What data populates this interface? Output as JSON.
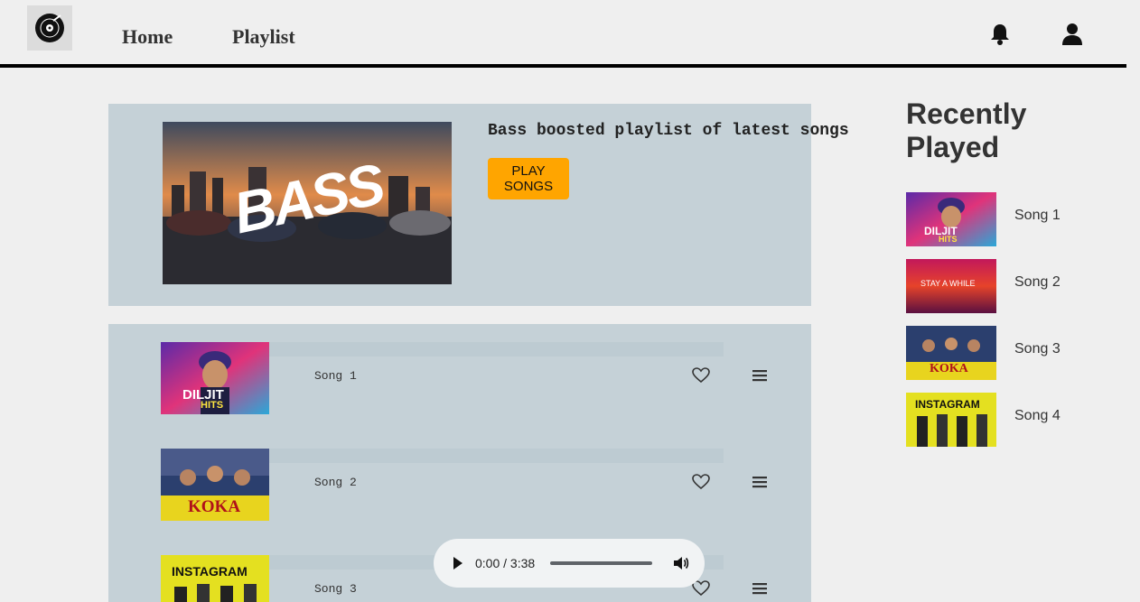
{
  "nav": {
    "logo_alt": "vinyl-record-logo",
    "home": "Home",
    "playlist": "Playlist",
    "bell_icon": "bell-icon",
    "user_icon": "user-icon"
  },
  "banner": {
    "art_text": "BASS",
    "title": "Bass boosted playlist of latest songs",
    "play_label_line1": "PLAY",
    "play_label_line2": "SONGS",
    "accent_color": "#ffa500"
  },
  "songs": [
    {
      "name": "Song 1",
      "art_line1": "DILJIT",
      "art_line2": "HITS"
    },
    {
      "name": "Song 2",
      "art_line1": "KOKA"
    },
    {
      "name": "Song 3",
      "art_line1": "INSTAGRAM"
    }
  ],
  "player": {
    "time": "0:00 / 3:38",
    "progress": 0
  },
  "recent": {
    "title_line1": "Recently",
    "title_line2": "Played",
    "items": [
      {
        "name": "Song 1",
        "art_line1": "DILJIT",
        "art_line2": "HITS"
      },
      {
        "name": "Song 2",
        "art_line1": "STAY A WHILE"
      },
      {
        "name": "Song 3",
        "art_line1": "KOKA"
      },
      {
        "name": "Song 4",
        "art_line1": "INSTAGRAM"
      }
    ]
  }
}
